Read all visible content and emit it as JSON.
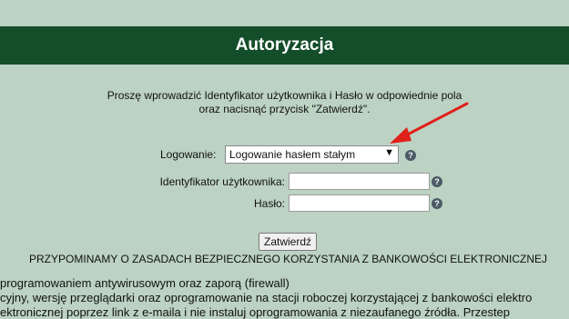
{
  "header": {
    "title": "Autoryzacja"
  },
  "intro": {
    "line1": "Proszę wprowadzić Identyfikator użytkownika i Hasło w odpowiednie pola",
    "line2": "oraz nacisnąć przycisk \"Zatwierdź\"."
  },
  "form": {
    "login_label": "Logowanie:",
    "login_selected": "Logowanie hasłem stałym",
    "user_label": "Identyfikator użytkownika:",
    "user_value": "",
    "password_label": "Hasło:",
    "password_value": "",
    "submit_label": "Zatwierdź",
    "help_glyph": "?",
    "dropdown_glyph": "▼"
  },
  "reminder": "PRZYPOMINAMY O ZASADACH BEZPIECZNEGO KORZYSTANIA Z BANKOWOŚCI ELEKTRONICZNEJ",
  "tips": [
    "programowaniem antywirusowym oraz zaporą (firewall)",
    "cyjny, wersję przeglądarki oraz oprogramowanie na stacji roboczej korzystającej z bankowości elektro",
    "ektronicznej poprzez link z e-maila i nie instaluj oprogramowania z niezaufanego źródła. Przestep"
  ],
  "colors": {
    "background": "#bcd2c3",
    "header": "#144d2a",
    "annotation_arrow": "#e0201b"
  }
}
